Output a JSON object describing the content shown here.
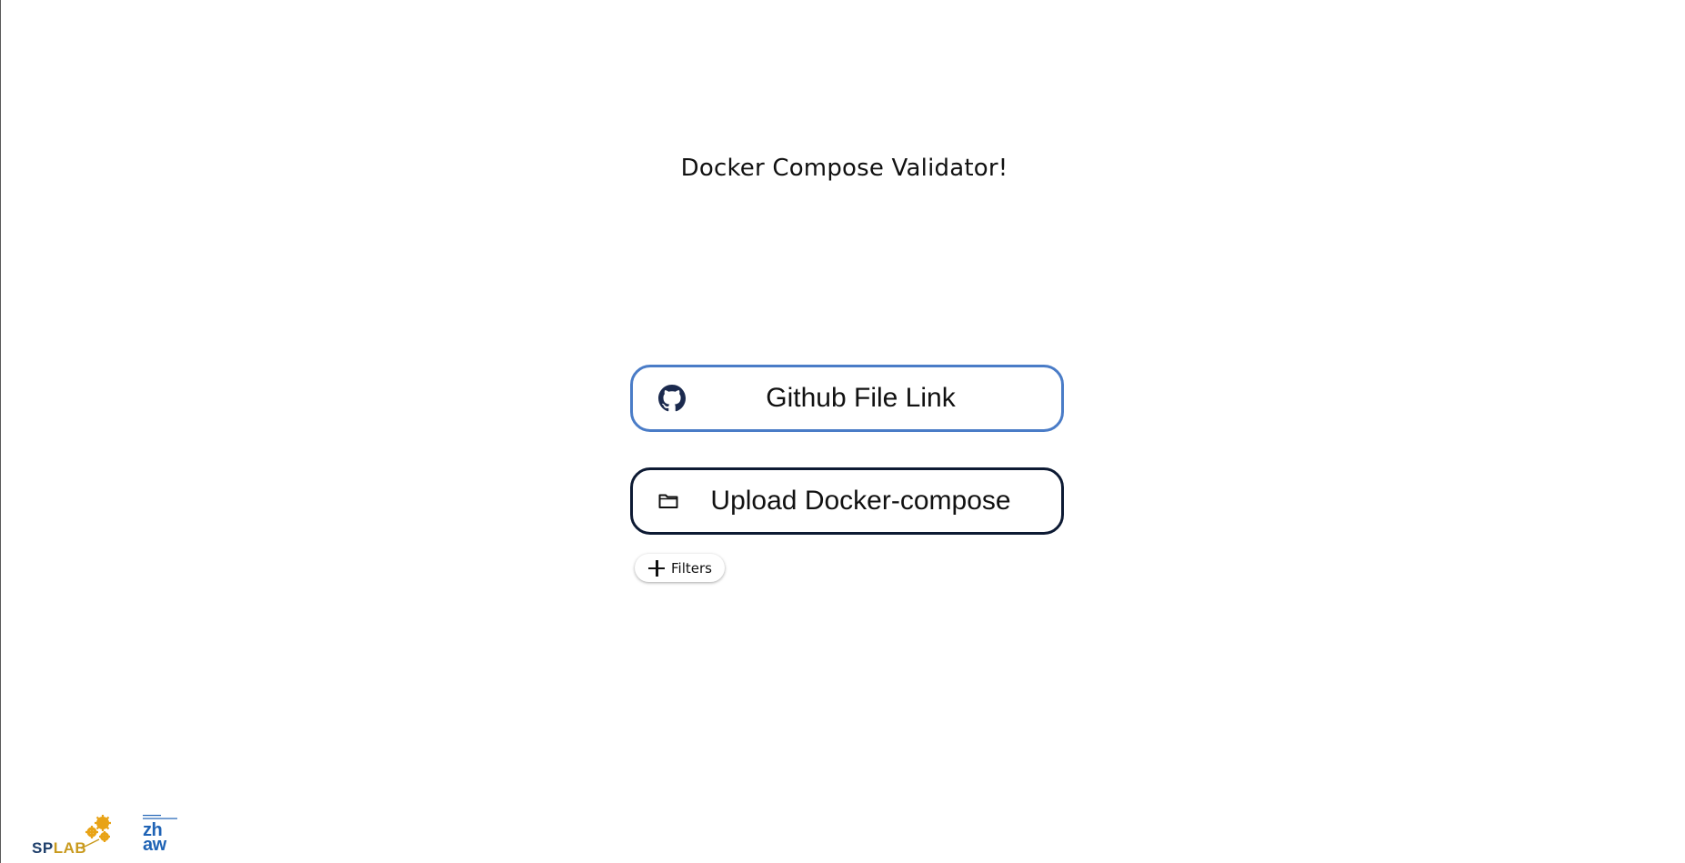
{
  "page": {
    "title": "Docker Compose Validator!"
  },
  "actions": {
    "github_button": {
      "label": "Github File Link",
      "icon": "github-icon"
    },
    "upload_button": {
      "label": "Upload Docker-compose",
      "icon": "folder-icon"
    },
    "filters_button": {
      "label": "Filters",
      "icon": "plus-icon"
    }
  },
  "footer": {
    "logos": [
      {
        "name": "SPLAB",
        "part1": "SP",
        "part2": "LAB"
      },
      {
        "name": "zhaw",
        "line1": "zh",
        "line2": "aw"
      }
    ]
  },
  "colors": {
    "github_border": "#4a7cc7",
    "upload_border": "#0d1a33",
    "splab_blue": "#1f3f6b",
    "splab_gold": "#c99a1e",
    "zhaw_blue": "#1f63b5"
  }
}
